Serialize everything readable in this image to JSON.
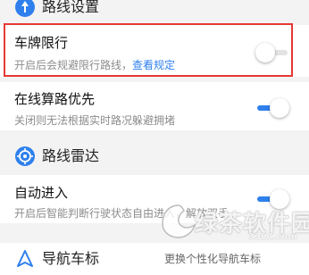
{
  "sections": {
    "route_settings": {
      "title": "路线设置",
      "icon": "navigation-arrow-icon"
    },
    "route_radar": {
      "title": "路线雷达",
      "icon": "radar-target-icon"
    },
    "nav_car_icon": {
      "title": "导航车标",
      "value": "更换个性化导航车标",
      "icon": "navigation-triangle-icon"
    }
  },
  "settings": {
    "plate_restriction": {
      "label": "车牌限行",
      "desc_prefix": "开启后会规避限行路线，",
      "desc_link": "查看规定",
      "enabled": false
    },
    "online_routing": {
      "label": "在线算路优先",
      "desc": "关闭则无法根据实时路况躲避拥堵",
      "enabled": true
    },
    "auto_enter": {
      "label": "自动进入",
      "desc": "开启后智能判断行驶状态自由进入，解放双手",
      "enabled": true
    }
  },
  "watermark": {
    "text": "绿茶软件园",
    "url": "33LC.com"
  },
  "colors": {
    "accent": "#2f80ed",
    "highlight": "#e53935",
    "background": "#f3f3f3"
  }
}
